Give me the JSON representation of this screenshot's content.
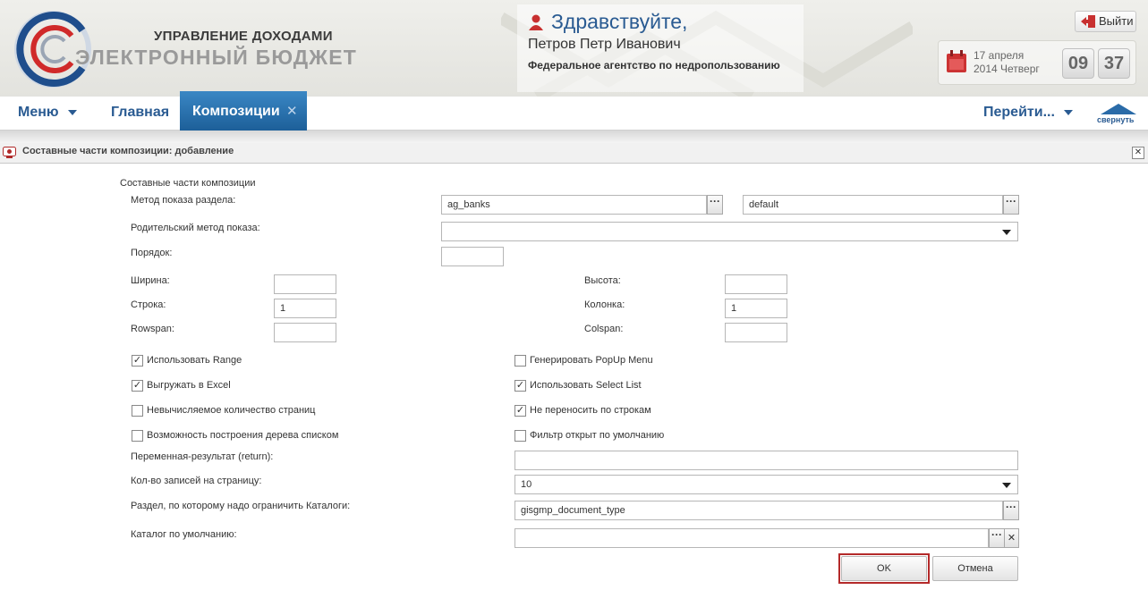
{
  "header": {
    "brand_top": "УПРАВЛЕНИЕ ДОХОДАМИ",
    "brand_bottom": "ЭЛЕКТРОННЫЙ БЮДЖЕТ",
    "greeting": "Здравствуйте,",
    "user_name": "Петров Петр Иванович",
    "agency": "Федеральное агентство по недропользованию",
    "logout_label": "Выйти",
    "date_line1": "17 апреля",
    "date_line2": "2014 Четверг",
    "clock_hours": "09",
    "clock_minutes": "37"
  },
  "nav": {
    "menu_label": "Меню",
    "home_label": "Главная",
    "active_tab_label": "Композиции",
    "active_tab_close": "✕",
    "goto_label": "Перейти...",
    "collapse_label": "свернуть"
  },
  "panel": {
    "title": "Составные части композиции: добавление",
    "close": "✕"
  },
  "form": {
    "section_label": "Составные части композиции",
    "method_label": "Метод показа раздела:",
    "method_value": "ag_banks",
    "method_value2": "default",
    "parent_method_label": "Родительский метод показа:",
    "parent_method_value": "",
    "order_label": "Порядок:",
    "order_value": "",
    "width_label": "Ширина:",
    "width_value": "",
    "height_label": "Высота:",
    "height_value": "",
    "row_label": "Строка:",
    "row_value": "1",
    "column_label": "Колонка:",
    "column_value": "1",
    "rowspan_label": "Rowspan:",
    "rowspan_value": "",
    "colspan_label": "Colspan:",
    "colspan_value": "",
    "checkboxes_left": [
      {
        "label": "Использовать Range",
        "checked": true,
        "mark": "✓"
      },
      {
        "label": "Выгружать в Excel",
        "checked": true,
        "mark": "✓"
      },
      {
        "label": "Невычисляемое количество страниц",
        "checked": false,
        "mark": ""
      },
      {
        "label": "Возможность построения дерева списком",
        "checked": false,
        "mark": ""
      }
    ],
    "checkboxes_right": [
      {
        "label": "Генерировать PopUp Menu",
        "checked": false,
        "mark": ""
      },
      {
        "label": "Использовать Select List",
        "checked": true,
        "mark": "✓"
      },
      {
        "label": "Не переносить по строкам",
        "checked": true,
        "mark": "✓"
      },
      {
        "label": "Фильтр открыт по умолчанию",
        "checked": false,
        "mark": ""
      }
    ],
    "return_var_label": "Переменная-результат (return):",
    "return_var_value": "",
    "per_page_label": "Кол-во записей на страницу:",
    "per_page_value": "10",
    "catalog_section_label": "Раздел, по которому надо ограничить Каталоги:",
    "catalog_section_value": "gisgmp_document_type",
    "default_catalog_label": "Каталог по умолчанию:",
    "default_catalog_value": "",
    "dots": "···",
    "clear": "✕",
    "ok_label": "OK",
    "cancel_label": "Отмена"
  },
  "colors": {
    "accent_blue": "#2a5b92",
    "active_tab": "#2a75b3",
    "highlight_red": "#b42a2a"
  }
}
